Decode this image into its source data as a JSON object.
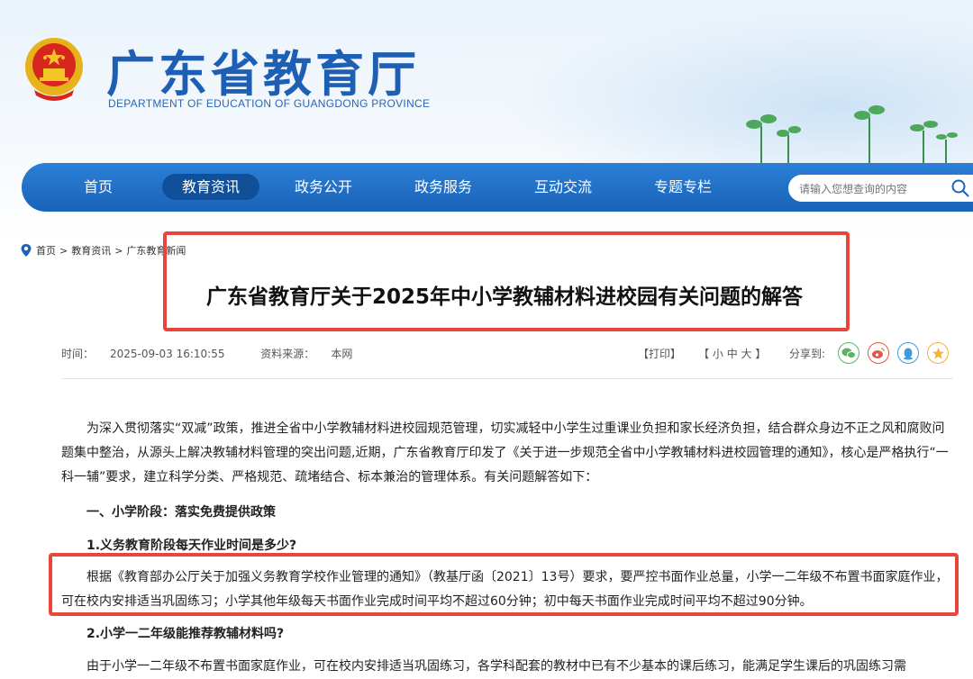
{
  "site": {
    "title": "广东省教育厅",
    "subtitle": "DEPARTMENT OF EDUCATION OF GUANGDONG PROVINCE"
  },
  "nav": {
    "items": [
      "首页",
      "教育资讯",
      "政务公开",
      "政务服务",
      "互动交流",
      "专题专栏"
    ],
    "active": "教育资讯"
  },
  "search": {
    "placeholder": "请输入您想查询的内容"
  },
  "breadcrumb": {
    "home": "首页",
    "sep": ">",
    "level1": "教育资讯",
    "level2": "广东教育新闻"
  },
  "article": {
    "title": "广东省教育厅关于2025年中小学教辅材料进校园有关问题的解答",
    "time_label": "时间：",
    "time": "2025-09-03 16:10:55",
    "source_label": "资料来源：",
    "source": "本网",
    "print": "【打印】",
    "font_size": "【 小  中  大 】",
    "share_label": "分享到:",
    "para1": "为深入贯彻落实“双减”政策，推进全省中小学教辅材料进校园规范管理，切实减轻中小学生过重课业负担和家长经济负担，结合群众身边不正之风和腐败问题集中整治，从源头上解决教辅材料管理的突出问题,近期，广东省教育厅印发了《关于进一步规范全省中小学教辅材料进校园管理的通知》，核心是严格执行“一科一辅”要求，建立科学分类、严格规范、疏堵结合、标本兼治的管理体系。有关问题解答如下：",
    "heading1": "一、小学阶段：落实免费提供政策",
    "heading2": "1.义务教育阶段每天作业时间是多少?",
    "para2": "根据《教育部办公厅关于加强义务教育学校作业管理的通知》（教基厅函〔2021〕13号）要求，要严控书面作业总量，小学一二年级不布置书面家庭作业，可在校内安排适当巩固练习；小学其他年级每天书面作业完成时间平均不超过60分钟；初中每天书面作业完成时间平均不超过90分钟。",
    "heading3": "2.小学一二年级能推荐教辅材料吗?",
    "para3": "由于小学一二年级不布置书面家庭作业，可在校内安排适当巩固练习，各学科配套的教材中已有不少基本的课后练习，能满足学生课后的巩固练习需"
  },
  "share_icons": [
    "wechat-icon",
    "weibo-icon",
    "qq-icon",
    "qzone-icon"
  ],
  "colors": {
    "brand": "#1d5fb5",
    "nav": "#1a63b8",
    "highlight": "#e8453c"
  }
}
